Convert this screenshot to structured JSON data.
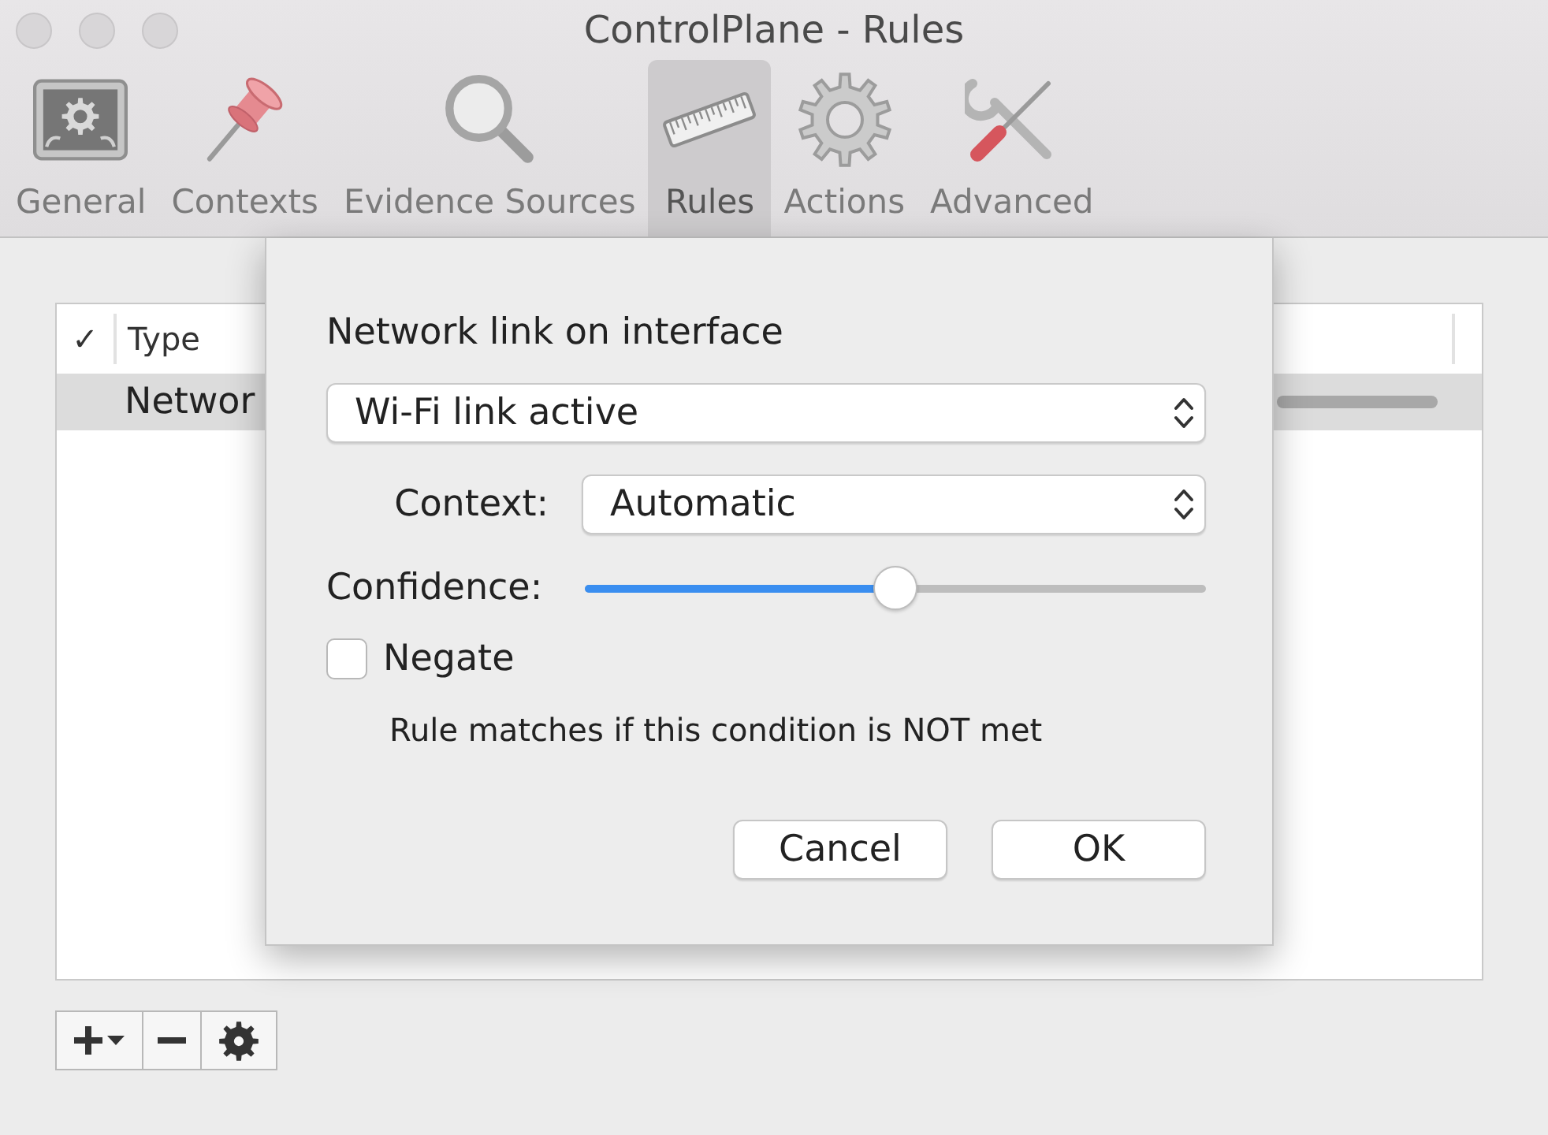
{
  "window": {
    "title": "ControlPlane - Rules"
  },
  "toolbar": [
    {
      "label": "General",
      "selected": false
    },
    {
      "label": "Contexts",
      "selected": false
    },
    {
      "label": "Evidence Sources",
      "selected": false
    },
    {
      "label": "Rules",
      "selected": true
    },
    {
      "label": "Actions",
      "selected": false
    },
    {
      "label": "Advanced",
      "selected": false
    }
  ],
  "table": {
    "columns": [
      "✓",
      "Type"
    ],
    "rows": [
      {
        "type": "Networ",
        "selected": true
      }
    ]
  },
  "sheet": {
    "heading": "Network link on interface",
    "condition": {
      "value": "Wi-Fi link active"
    },
    "context": {
      "label": "Context:",
      "value": "Automatic"
    },
    "confidence": {
      "label": "Confidence:",
      "level": 0.5
    },
    "negate": {
      "label": "Negate",
      "checked": false
    },
    "hint": "Rule matches if this condition is NOT met",
    "buttons": [
      "Cancel",
      "OK"
    ]
  }
}
